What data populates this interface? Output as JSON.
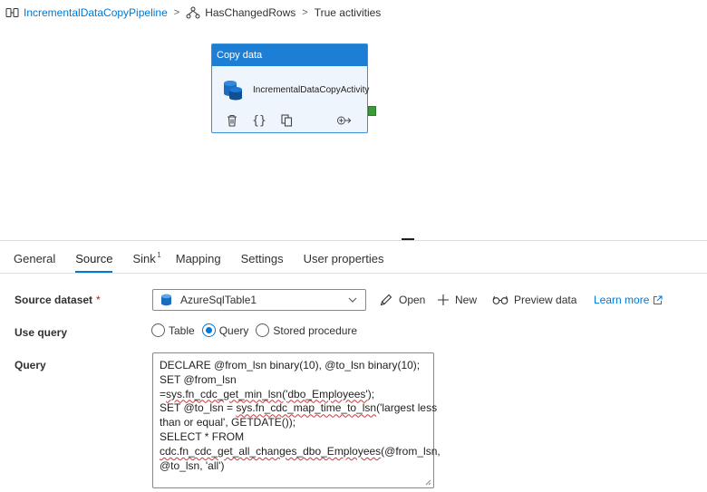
{
  "breadcrumb": {
    "pipeline": "IncrementalDataCopyPipeline",
    "condition": "HasChangedRows",
    "branch": "True activities",
    "pipeline_icon": "pipeline-icon",
    "condition_icon": "if-condition-icon"
  },
  "activity": {
    "type": "Copy data",
    "name": "IncrementalDataCopyActivity",
    "icon": "database-stack-icon",
    "tools": [
      "delete-icon",
      "code-braces-icon",
      "copy-icon",
      "add-output-icon"
    ]
  },
  "tabs": [
    {
      "label": "General",
      "active": false
    },
    {
      "label": "Source",
      "active": true
    },
    {
      "label": "Sink",
      "active": false,
      "badge": "1"
    },
    {
      "label": "Mapping",
      "active": false
    },
    {
      "label": "Settings",
      "active": false
    },
    {
      "label": "User properties",
      "active": false
    }
  ],
  "source": {
    "dataset_label": "Source dataset",
    "required_mark": "*",
    "dataset_value": "AzureSqlTable1",
    "open_label": "Open",
    "new_label": "New",
    "preview_label": "Preview data",
    "learn_more_label": "Learn more",
    "use_query_label": "Use query",
    "options": [
      {
        "label": "Table",
        "checked": false
      },
      {
        "label": "Query",
        "checked": true
      },
      {
        "label": "Stored procedure",
        "checked": false
      }
    ],
    "query_label": "Query",
    "query_lines": [
      "DECLARE @from_lsn binary(10), @to_lsn binary(10);",
      "SET @from_lsn",
      "=sys.fn_cdc_get_min_lsn('dbo_Employees');",
      "SET @to_lsn = sys.fn_cdc_map_time_to_lsn('largest less",
      "than or equal', GETDATE());",
      "SELECT * FROM",
      "cdc.fn_cdc_get_all_changes_dbo_Employees(@from_lsn,",
      "@to_lsn, 'all')"
    ]
  },
  "colors": {
    "accent": "#0078d4",
    "card_header": "#1d7ed5",
    "success_port": "#3a9a3a",
    "error_squiggle": "#d13438"
  }
}
